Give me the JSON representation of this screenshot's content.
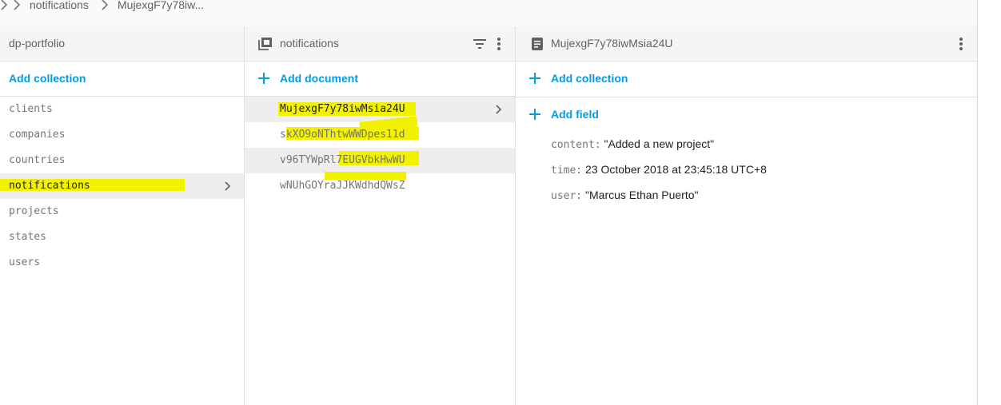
{
  "breadcrumb": {
    "items": [
      "notifications",
      "MujexgF7y78iw..."
    ]
  },
  "root_panel": {
    "title": "dp-portfolio",
    "add_label": "Add collection",
    "collections": [
      "clients",
      "companies",
      "countries",
      "notifications",
      "projects",
      "states",
      "users"
    ],
    "selected_index": 3
  },
  "collection_panel": {
    "title": "notifications",
    "add_label": "Add document",
    "documents": [
      "MujexgF7y78iwMsia24U",
      "skXO9oNThtwWWDpes11d",
      "v96TYWpRl7EUGVbkHwWU",
      "wNUhGOYraJJKWdhdQWsZ"
    ],
    "selected_index": 0
  },
  "document_panel": {
    "title": "MujexgF7y78iwMsia24U",
    "add_collection_label": "Add collection",
    "add_field_label": "Add field",
    "fields": [
      {
        "key": "content:",
        "value": "\"Added a new project\""
      },
      {
        "key": "time:",
        "value": "23 October 2018 at 23:45:18 UTC+8"
      },
      {
        "key": "user:",
        "value": "\"Marcus Ethan Puerto\""
      }
    ]
  },
  "colors": {
    "accent": "#039be5",
    "highlight": "#f2f200",
    "selected_row": "#eeeeee"
  },
  "icons": [
    "chevron-right-icon",
    "collection-icon",
    "filter-icon",
    "more-vert-icon",
    "document-icon",
    "plus-icon"
  ]
}
